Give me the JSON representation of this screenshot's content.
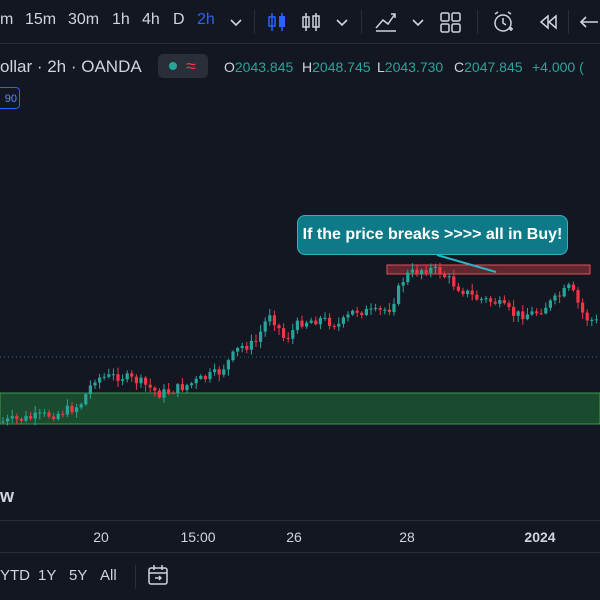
{
  "toolbar": {
    "timeframes": [
      {
        "label": "m",
        "active": false
      },
      {
        "label": "15m",
        "active": false
      },
      {
        "label": "30m",
        "active": false
      },
      {
        "label": "1h",
        "active": false
      },
      {
        "label": "4h",
        "active": false
      },
      {
        "label": "D",
        "active": false
      },
      {
        "label": "2h",
        "active": true
      }
    ],
    "icons": [
      "chevron-down-icon",
      "candles-icon",
      "bars-icon",
      "chevron-down-icon",
      "indicators-icon",
      "chevron-down-icon",
      "layout-grid-icon",
      "alert-clock-icon",
      "replay-icon",
      "undo-icon"
    ]
  },
  "symbol": {
    "name": "ollar · 2h · OANDA",
    "open_label": "O",
    "open": "2043.845",
    "high_label": "H",
    "high": "2048.745",
    "low_label": "L",
    "low": "2043.730",
    "close_label": "C",
    "close": "2047.845",
    "change": "+4.000 (",
    "badge": "90"
  },
  "annotation": {
    "text": "If the price breaks >>>> all in Buy!"
  },
  "colors": {
    "up": "#26a69a",
    "down": "#f23645",
    "accent": "#2962ff",
    "zone_green": "#1e5d33",
    "zone_red": "#a2333a",
    "callout": "#0f7a87"
  },
  "xaxis": {
    "labels": [
      {
        "text": "20",
        "bold": false
      },
      {
        "text": "15:00",
        "bold": false
      },
      {
        "text": "26",
        "bold": false
      },
      {
        "text": "28",
        "bold": false
      },
      {
        "text": "2024",
        "bold": true
      }
    ]
  },
  "bottom": {
    "ranges": [
      "YTD",
      "1Y",
      "5Y",
      "All"
    ],
    "goto_icon": "calendar-goto-icon"
  },
  "watermark": "w"
}
